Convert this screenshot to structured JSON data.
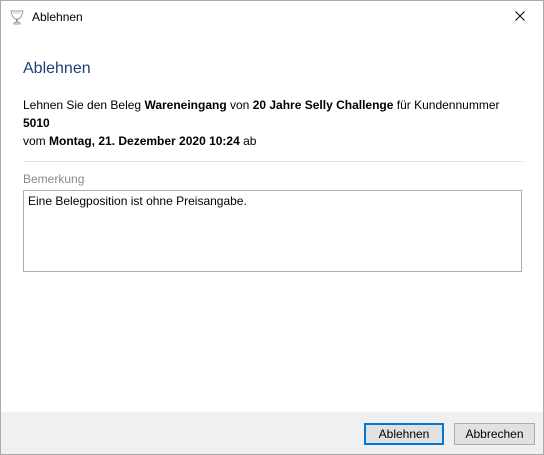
{
  "window": {
    "title": "Ablehnen"
  },
  "dialog": {
    "heading": "Ablehnen",
    "description": {
      "p1": "Lehnen Sie den Beleg ",
      "doc_type": "Wareneingang",
      "p2": " von ",
      "company": "20 Jahre Selly Challenge",
      "p3": " für Kundennummer ",
      "customer_number": "5010",
      "p4": " vom ",
      "date": "Montag, 21. Dezember 2020 10:24",
      "p5": " ab"
    },
    "remark_label": "Bemerkung",
    "remark_value": "Eine Belegposition ist ohne Preisangabe."
  },
  "buttons": {
    "reject_label": "Ablehnen",
    "cancel_label": "Abbrechen"
  },
  "colors": {
    "heading": "#1e3d7b",
    "accent": "#0078d7",
    "footer_bg": "#f0f0f0"
  },
  "icons": {
    "app": "wine-glass-icon",
    "close": "close-icon"
  }
}
